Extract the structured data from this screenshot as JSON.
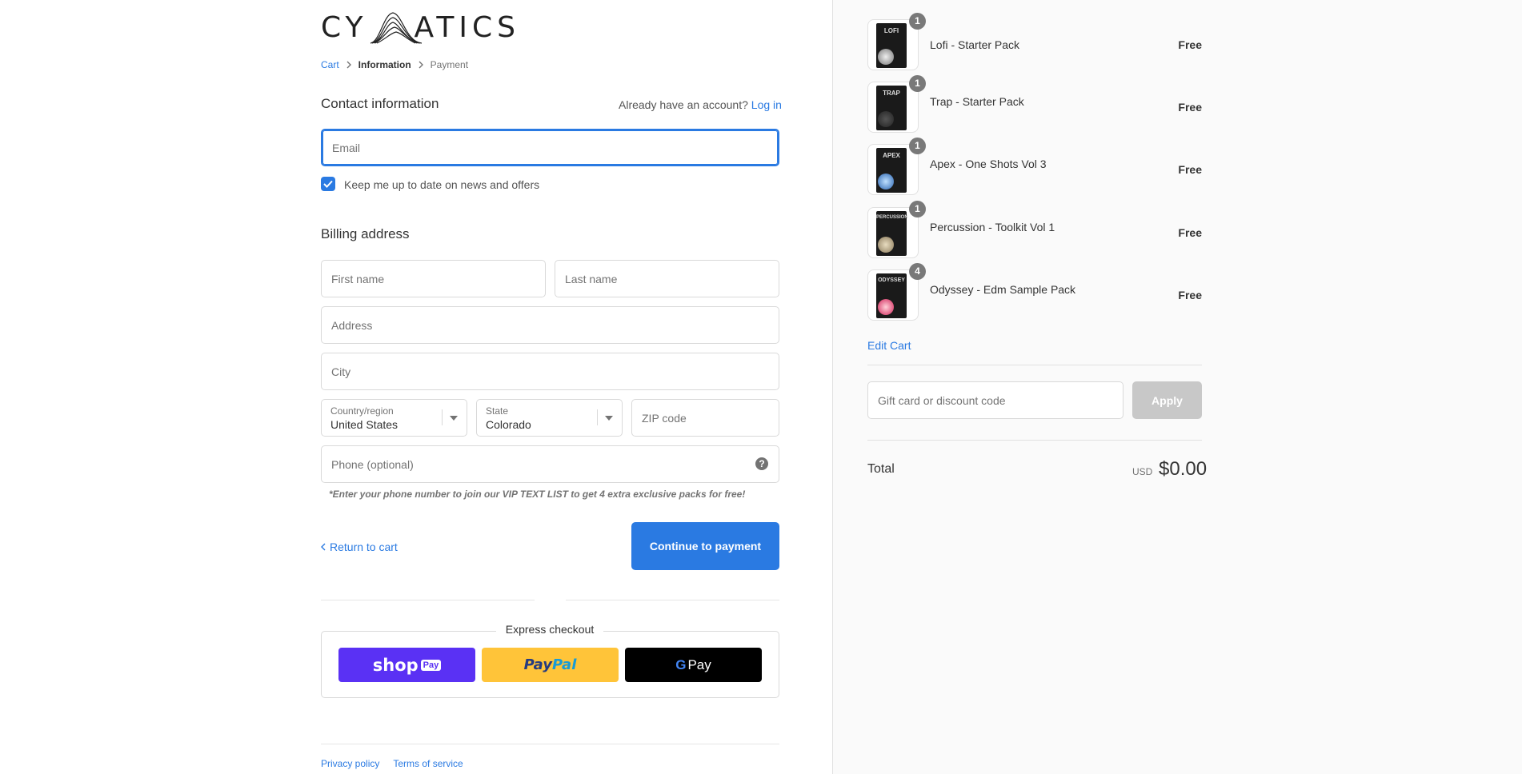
{
  "brand": {
    "logo_text_left": "CY",
    "logo_text_right": "ATICS"
  },
  "breadcrumb": {
    "cart": "Cart",
    "information": "Information",
    "payment": "Payment"
  },
  "contact": {
    "title": "Contact information",
    "account_prompt": "Already have an account?",
    "login": "Log in",
    "email_placeholder": "Email",
    "newsletter_label": "Keep me up to date on news and offers",
    "newsletter_checked": true
  },
  "billing": {
    "title": "Billing address",
    "first_name_placeholder": "First name",
    "last_name_placeholder": "Last name",
    "address_placeholder": "Address",
    "city_placeholder": "City",
    "country_label": "Country/region",
    "country_value": "United States",
    "state_label": "State",
    "state_value": "Colorado",
    "zip_placeholder": "ZIP code",
    "phone_placeholder": "Phone (optional)",
    "phone_note": "*Enter your phone number to join our VIP TEXT LIST to get 4 extra exclusive packs for free!"
  },
  "actions": {
    "return": "Return to cart",
    "continue": "Continue to payment"
  },
  "express": {
    "label": "Express checkout",
    "shop_pay": "shop",
    "shop_pay_pill": "Pay",
    "paypal_1": "Pay",
    "paypal_2": "Pal",
    "gpay_g": "G",
    "gpay_text": "Pay"
  },
  "footer": {
    "privacy": "Privacy policy",
    "terms": "Terms of service"
  },
  "cart": {
    "items": [
      {
        "name": "Lofi - Starter Pack",
        "price": "Free",
        "qty": "1",
        "art": "LOFI"
      },
      {
        "name": "Trap - Starter Pack",
        "price": "Free",
        "qty": "1",
        "art": "TRAP"
      },
      {
        "name": "Apex - One Shots Vol 3",
        "price": "Free",
        "qty": "1",
        "art": "APEX"
      },
      {
        "name": "Percussion - Toolkit Vol 1",
        "price": "Free",
        "qty": "1",
        "art": "PERCUSSION"
      },
      {
        "name": "Odyssey - Edm Sample Pack",
        "price": "Free",
        "qty": "4",
        "art": "ODYSSEY"
      }
    ],
    "edit_cart": "Edit Cart",
    "discount_placeholder": "Gift card or discount code",
    "apply": "Apply",
    "total_label": "Total",
    "currency": "USD",
    "total_value": "$0.00"
  },
  "colors": {
    "accent": "#2a7ae2",
    "shop_pay": "#5a31f4",
    "paypal": "#ffc439",
    "apply_disabled": "#c8c8c8"
  }
}
